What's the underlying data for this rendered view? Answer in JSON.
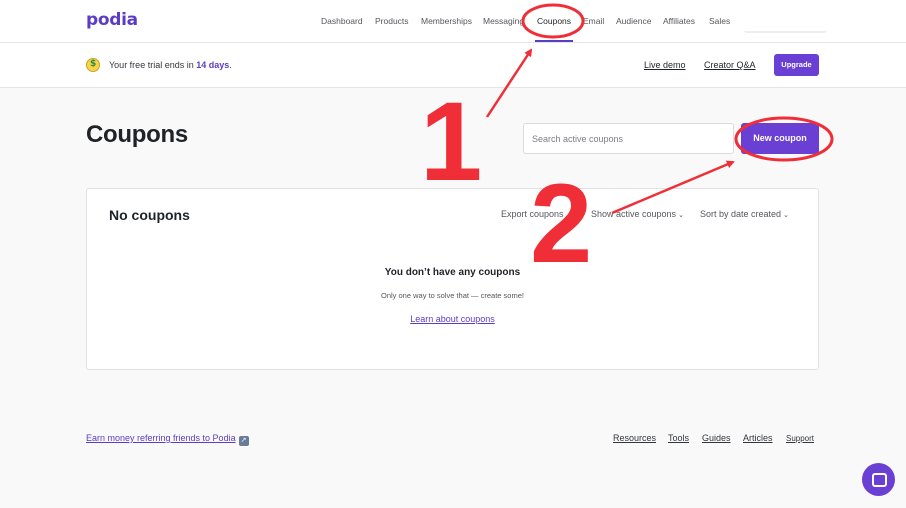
{
  "brand": {
    "logo": "podia",
    "accent": "#5b3cc4",
    "button_color": "#6a3fd4",
    "annotation_color": "#f02e37"
  },
  "nav": {
    "items": [
      {
        "label": "Dashboard"
      },
      {
        "label": "Products"
      },
      {
        "label": "Memberships"
      },
      {
        "label": "Messaging"
      },
      {
        "label": "Coupons",
        "active": true
      },
      {
        "label": "Email"
      },
      {
        "label": "Audience"
      },
      {
        "label": "Affiliates"
      },
      {
        "label": "Sales"
      }
    ]
  },
  "trial_bar": {
    "icon": "money-face-icon",
    "text_before": "Your free trial ends in ",
    "days": "14 days",
    "text_after": ".",
    "live_demo": "Live demo",
    "creator_qa": "Creator Q&A",
    "upgrade": "Upgrade"
  },
  "page": {
    "title": "Coupons",
    "search_placeholder": "Search active coupons",
    "new_coupon": "New coupon"
  },
  "card": {
    "title": "No coupons",
    "export": "Export coupons",
    "filter": "Show active coupons",
    "sort": "Sort by date created",
    "empty_heading": "You don’t have any coupons",
    "empty_sub": "Only one way to solve that — create some!",
    "learn_link": "Learn about coupons"
  },
  "footer": {
    "referral": "Earn money referring friends to Podia",
    "links": [
      "Resources",
      "Tools",
      "Guides",
      "Articles",
      "Support"
    ]
  },
  "annotations": {
    "step1": "1",
    "step2": "2"
  }
}
